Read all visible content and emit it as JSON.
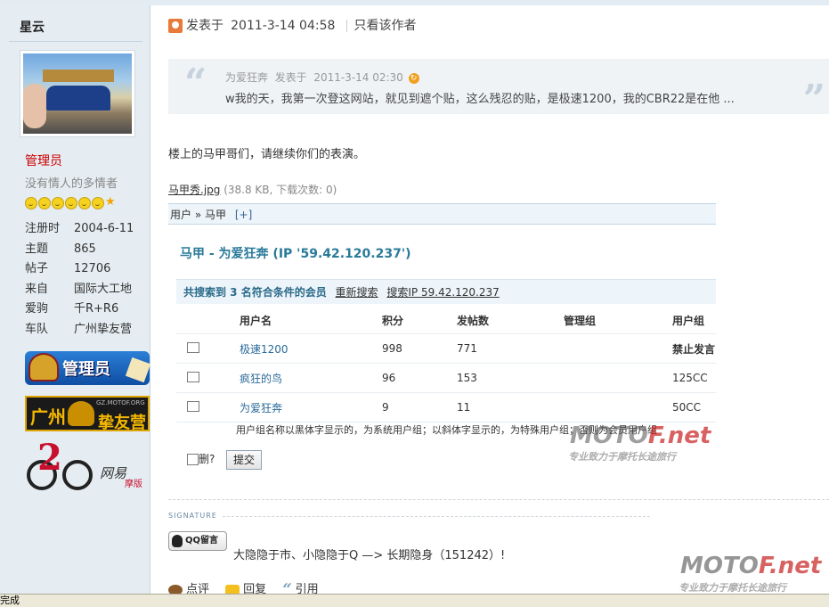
{
  "sidebar": {
    "username": "星云",
    "group": "管理员",
    "user_title": "没有情人的多情者",
    "profile": [
      {
        "key": "注册时",
        "value": "2004-6-11"
      },
      {
        "key": "主题",
        "value": "865"
      },
      {
        "key": "帖子",
        "value": "12706"
      },
      {
        "key": "来自",
        "value": "国际大工地"
      },
      {
        "key": "爱驹",
        "value": "千R+R6"
      },
      {
        "key": "车队",
        "value": "广州挚友营"
      }
    ],
    "badges": {
      "admin": "管理员",
      "gz_1": "广州",
      "gz_2": "GZ.MOTOF.ORG",
      "gz_3": "挚友营",
      "net_1": "2",
      "net_2": "网易",
      "net_3": "摩版"
    }
  },
  "post": {
    "posted_label": "发表于",
    "posted_time": "2011-3-14 04:58",
    "only_author": "只看该作者",
    "quote": {
      "author": "为爱狂奔",
      "posted_label": "发表于",
      "time": "2011-3-14 02:30",
      "text": "w我的天，我第一次登这网站，就见到遮个贴，这么残忍的贴，是极速1200，我的CBR22是在他 ..."
    },
    "message": "楼上的马甲哥们，请继续你们的表演。",
    "attachment": {
      "name": "马甲秀.jpg",
      "meta": "(38.8 KB, 下载次数: 0)"
    }
  },
  "embed": {
    "breadcrumb_1": "用户",
    "breadcrumb_sep": "»",
    "breadcrumb_2": "马甲",
    "breadcrumb_plus": "[+]",
    "heading": "马甲 - 为爱狂奔 (IP '59.42.120.237')",
    "search_result": "共搜索到 3 名符合条件的会员",
    "research": "重新搜索",
    "search_ip": "搜索IP 59.42.120.237",
    "columns": [
      "用户名",
      "积分",
      "发帖数",
      "管理组",
      "用户组"
    ],
    "rows": [
      {
        "name": "极速1200",
        "points": "998",
        "posts": "771",
        "admin_group": "",
        "user_group": "禁止发言"
      },
      {
        "name": "疯狂的鸟",
        "points": "96",
        "posts": "153",
        "admin_group": "",
        "user_group": "125CC"
      },
      {
        "name": "为爱狂奔",
        "points": "9",
        "posts": "11",
        "admin_group": "",
        "user_group": "50CC"
      }
    ],
    "note": "用户组名称以黑体字显示的，为系统用户组；以斜体字显示的，为特殊用户组；否则为会员用户组",
    "delete_label": "删?",
    "submit_label": "提交"
  },
  "signature": {
    "label": "SIGNATURE",
    "qq_label": "QQ留言",
    "text": "大隐隐于市、小隐隐于Q —> 长期隐身（151242）!"
  },
  "actions": {
    "rate": "点评",
    "reply": "回复",
    "quote": "引用"
  },
  "watermark": {
    "brand_a": "MOTO",
    "brand_b": "F.net",
    "slogan": "专业致力于摩托长途旅行"
  },
  "statusbar": {
    "text": "完成"
  }
}
